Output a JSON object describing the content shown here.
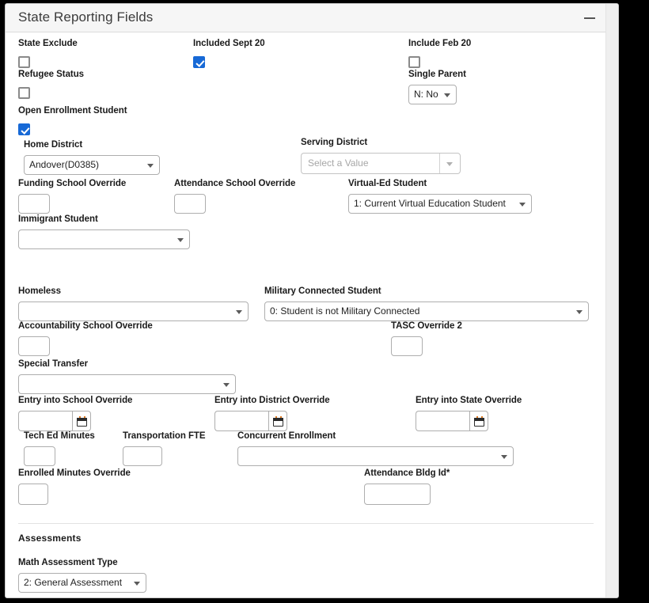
{
  "panel": {
    "title": "State Reporting Fields",
    "collapse_icon": "minus-icon"
  },
  "fields": {
    "state_exclude": {
      "label": "State Exclude",
      "type": "checkbox",
      "checked": false
    },
    "included_sept_20": {
      "label": "Included Sept 20",
      "type": "checkbox",
      "checked": true
    },
    "include_feb_20": {
      "label": "Include Feb 20",
      "type": "checkbox",
      "checked": false
    },
    "refugee_status": {
      "label": "Refugee Status",
      "type": "checkbox",
      "checked": false
    },
    "single_parent": {
      "label": "Single Parent",
      "type": "select",
      "value": "N: No"
    },
    "open_enrollment_student": {
      "label": "Open Enrollment Student",
      "type": "checkbox",
      "checked": true
    },
    "home_district": {
      "label": "Home District",
      "type": "select",
      "value": "Andover(D0385)"
    },
    "serving_district": {
      "label": "Serving District",
      "type": "select-split",
      "value": "",
      "placeholder": "Select a Value",
      "disabled": true
    },
    "funding_school_override": {
      "label": "Funding School Override",
      "type": "text",
      "value": ""
    },
    "attendance_school_override": {
      "label": "Attendance School Override",
      "type": "text",
      "value": ""
    },
    "virtual_ed_student": {
      "label": "Virtual-Ed Student",
      "type": "select",
      "value": "1: Current Virtual Education Student"
    },
    "immigrant_student": {
      "label": "Immigrant Student",
      "type": "select",
      "value": ""
    },
    "homeless": {
      "label": "Homeless",
      "type": "select",
      "value": ""
    },
    "military_connected_student": {
      "label": "Military Connected Student",
      "type": "select",
      "value": "0: Student is not Military Connected"
    },
    "accountability_school_override": {
      "label": "Accountability School Override",
      "type": "text",
      "value": ""
    },
    "tasc_override_2": {
      "label": "TASC Override 2",
      "type": "text",
      "value": ""
    },
    "special_transfer": {
      "label": "Special Transfer",
      "type": "select",
      "value": ""
    },
    "entry_into_school_override": {
      "label": "Entry into School Override",
      "type": "date",
      "value": "",
      "icon": "calendar-icon"
    },
    "entry_into_district_override": {
      "label": "Entry into District Override",
      "type": "date",
      "value": "",
      "icon": "calendar-icon"
    },
    "entry_into_state_override": {
      "label": "Entry into State Override",
      "type": "date",
      "value": "",
      "icon": "calendar-icon"
    },
    "tech_ed_minutes": {
      "label": "Tech Ed Minutes",
      "type": "text",
      "value": ""
    },
    "transportation_fte": {
      "label": "Transportation FTE",
      "type": "text",
      "value": ""
    },
    "concurrent_enrollment": {
      "label": "Concurrent Enrollment",
      "type": "select",
      "value": ""
    },
    "enrolled_minutes_override": {
      "label": "Enrolled Minutes Override",
      "type": "text",
      "value": ""
    },
    "attendance_bldg_id": {
      "label": "Attendance Bldg Id*",
      "type": "text",
      "value": ""
    }
  },
  "sections": {
    "assessments": {
      "heading": "Assessments",
      "math_assessment_type": {
        "label": "Math Assessment Type",
        "type": "select",
        "value": "2: General Assessment"
      }
    }
  },
  "colors": {
    "checkbox_checked": "#1769d6",
    "header_bg": "#f6f6f6",
    "border": "#aeaeae",
    "calendar_accent": "#e07a20"
  }
}
